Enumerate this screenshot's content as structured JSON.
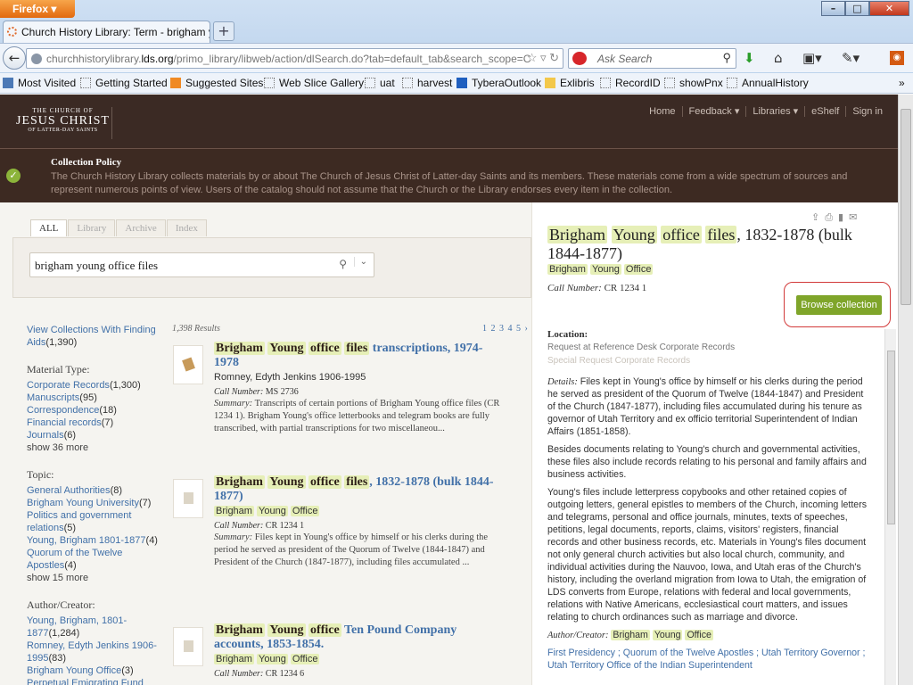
{
  "browser": {
    "app_button": "Firefox",
    "tab_title": "Church History Library: Term - brigham y...",
    "url_prefix": "churchhistorylibrary.",
    "url_domain": "lds.org",
    "url_path": "/primo_library/libweb/action/dlSearch.do?tab=default_tab&search_scope=C",
    "search_placeholder": "Ask Search",
    "bookmarks": [
      "Most Visited",
      "Getting Started",
      "Suggested Sites",
      "Web Slice Gallery",
      "uat",
      "harvest",
      "TyberaOutlook",
      "Exlibris",
      "RecordID",
      "showPnx",
      "AnnualHistory"
    ]
  },
  "site": {
    "logo": {
      "line1": "THE CHURCH OF",
      "line2": "JESUS CHRIST",
      "line3": "OF LATTER-DAY SAINTS"
    },
    "topnav": [
      "Home",
      "Feedback ▾",
      "Libraries ▾",
      "eShelf",
      "Sign in"
    ],
    "policy": {
      "title": "Collection Policy",
      "body": "The Church History Library collects materials by or about The Church of Jesus Christ of Latter-day Saints and its members. These materials come from a wide spectrum of sources and represent numerous points of view. Users of the catalog should not assume that the Church or the Library endorses every item in the collection."
    }
  },
  "search": {
    "tabs": [
      "ALL",
      "Library",
      "Archive",
      "Index"
    ],
    "query": "brigham young office files"
  },
  "facets": {
    "view_collections": "View Collections With Finding Aids",
    "view_collections_count": "(1,390)",
    "material_type_head": "Material Type:",
    "material_types": [
      {
        "label": "Corporate Records",
        "count": "(1,300)"
      },
      {
        "label": "Manuscripts",
        "count": "(95)"
      },
      {
        "label": "Correspondence",
        "count": "(18)"
      },
      {
        "label": "Financial records",
        "count": "(7)"
      },
      {
        "label": "Journals",
        "count": "(6)"
      }
    ],
    "material_more": "show 36 more",
    "topic_head": "Topic:",
    "topics": [
      {
        "label": "General Authorities",
        "count": "(8)"
      },
      {
        "label": "Brigham Young University",
        "count": "(7)"
      },
      {
        "label": "Politics and government relations",
        "count": "(5)"
      },
      {
        "label": "Young, Brigham 1801-1877",
        "count": "(4)"
      },
      {
        "label": "Quorum of the Twelve Apostles",
        "count": "(4)"
      }
    ],
    "topic_more": "show 15 more",
    "author_head": "Author/Creator:",
    "authors": [
      {
        "label": "Young, Brigham, 1801-1877",
        "count": "(1,284)"
      },
      {
        "label": "Romney, Edyth Jenkins 1906-1995",
        "count": "(83)"
      },
      {
        "label": "Brigham Young Office",
        "count": "(3)"
      },
      {
        "label": "Perpetual Emigrating Fund",
        "count": ""
      }
    ]
  },
  "results": {
    "count_text": "1,398 Results",
    "pager": "1 2 3 4 5 ›",
    "items": [
      {
        "title_hl": [
          "Brigham",
          "Young",
          "office",
          "files"
        ],
        "title_rest": "transcriptions, 1974-1978",
        "author": "Romney, Edyth Jenkins 1906-1995",
        "call_label": "Call Number:",
        "call": "MS 2736",
        "summary_label": "Summary:",
        "summary": "Transcripts of certain portions of Brigham Young office files (CR 1234 1). Brigham Young's office letterbooks and telegram books are fully transcribed, with partial transcriptions for two miscellaneou..."
      },
      {
        "title_hl": [
          "Brigham",
          "Young",
          "office",
          "files"
        ],
        "title_rest": ", 1832-1878 (bulk 1844-1877)",
        "author_hl": [
          "Brigham",
          "Young",
          "Office"
        ],
        "call_label": "Call Number:",
        "call": "CR 1234 1",
        "summary_label": "Summary:",
        "summary": "Files kept in Young's office by himself or his clerks during the period he served as president of the Quorum of Twelve (1844-1847) and President of the Church (1847-1877), including files accumulated ..."
      },
      {
        "title_hl": [
          "Brigham",
          "Young",
          "office"
        ],
        "title_rest": "Ten Pound Company accounts, 1853-1854.",
        "author_hl": [
          "Brigham",
          "Young",
          "Office"
        ],
        "call_label": "Call Number:",
        "call": "CR 1234 6"
      }
    ]
  },
  "detail": {
    "title_hl": [
      "Brigham",
      "Young",
      "office",
      "files"
    ],
    "title_rest": ", 1832-1878 (bulk 1844-1877)",
    "author_hl": [
      "Brigham",
      "Young",
      "Office"
    ],
    "call_label": "Call Number:",
    "call": "CR 1234 1",
    "browse_button": "Browse collection",
    "location_head": "Location:",
    "location_1": "Request at Reference Desk Corporate Records",
    "location_2": "Special Request Corporate Records",
    "details_label": "Details:",
    "details": "Files kept in Young's office by himself or his clerks during the period he served as president of the Quorum of Twelve (1844-1847) and President of the Church (1847-1877), including files accumulated during his tenure as governor of Utah Territory and ex officio territorial Superintendent of Indian Affairs (1851-1858).",
    "para2": "Besides documents relating to Young's church and governmental activities, these files also include records relating to his personal and family affairs and business activities.",
    "para3": "Young's files include letterpress copybooks and other retained copies of outgoing letters, general epistles to members of the Church, incoming letters and telegrams, personal and office journals, minutes, texts of speeches, petitions, legal documents, reports, claims, visitors' registers, financial records and other business records, etc. Materials in Young's files document not only general church activities but also local church, community, and individual activities during the Nauvoo, Iowa, and Utah eras of the Church's history, including the overland migration from Iowa to Utah, the emigration of LDS converts from Europe, relations with federal and local governments, relations with Native Americans, ecclesiastical court matters, and issues relating to church ordinances such as marriage and divorce.",
    "author_label": "Author/Creator:",
    "subjects": "First Presidency ; Quorum of the Twelve Apostles ; Utah Territory Governor ; Utah Territory Office of the Indian Superintendent"
  },
  "colors": {
    "header_bg": "#3b2a24",
    "accent_green": "#7fa52a",
    "link_blue": "#4170a8",
    "highlight": "#e6efb7"
  }
}
